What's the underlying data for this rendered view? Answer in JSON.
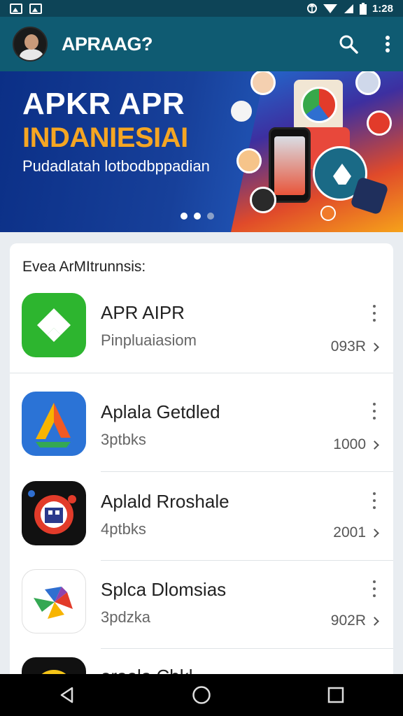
{
  "status_bar": {
    "time": "1:28",
    "icons": [
      "image-icon",
      "gallery-icon",
      "data-icon",
      "wifi-icon",
      "signal-icon",
      "battery-icon"
    ]
  },
  "app_bar": {
    "title": "APRAAG?",
    "icons": [
      "search-icon",
      "more-vert-icon"
    ]
  },
  "banner": {
    "title": "APKR APR",
    "subtitle": "INDANIESIAI",
    "tagline": "Pudadlatah lotbodbppadian",
    "active_slide": 2,
    "slide_count": 3
  },
  "list": {
    "header": "Evea ArMItrunnsis:",
    "items": [
      {
        "name": "APR AIPR",
        "subtitle": "Pinpluaiasiom",
        "meta": "093R",
        "icon": "apr-app-icon",
        "icon_color": "#2db52f"
      },
      {
        "name": "Aplala Getdled",
        "subtitle": "3ptbks",
        "meta": "1000",
        "icon": "drive-app-icon",
        "icon_color": "#2b73d6"
      },
      {
        "name": "Aplald Rroshale",
        "subtitle": "4ptbks",
        "meta": "2001",
        "icon": "robot-app-icon",
        "icon_color": "#111111"
      },
      {
        "name": "Splca Dlomsias",
        "subtitle": "3pdzka",
        "meta": "902R",
        "icon": "pinwheel-app-icon",
        "icon_color": "#ffffff"
      },
      {
        "name": "oraela Cbkl",
        "subtitle": "",
        "meta": "",
        "icon": "yellow-app-icon",
        "icon_color": "#f5c518"
      }
    ]
  },
  "nav_bar": {
    "buttons": [
      "back-icon",
      "home-icon",
      "recents-icon"
    ]
  },
  "colors": {
    "status_bar": "#0d4457",
    "app_bar": "#0f5b72",
    "banner_accent": "#f5a623",
    "background": "#e9edf1"
  }
}
